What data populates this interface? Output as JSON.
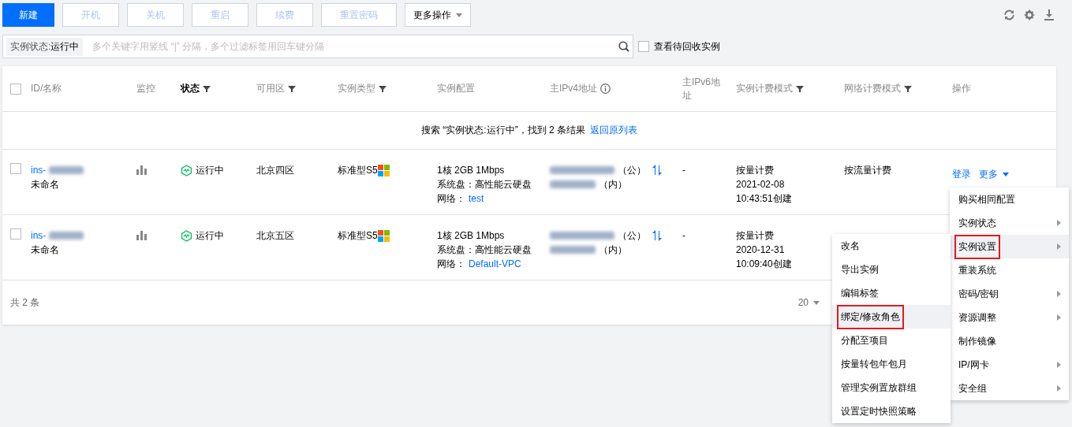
{
  "toolbar": {
    "buttons": [
      {
        "label": "新建",
        "kind": "primary",
        "disabled": false
      },
      {
        "label": "开机",
        "kind": "default",
        "disabled": true
      },
      {
        "label": "关机",
        "kind": "default",
        "disabled": true
      },
      {
        "label": "重启",
        "kind": "default",
        "disabled": true
      },
      {
        "label": "续费",
        "kind": "default",
        "disabled": true
      },
      {
        "label": "重置密码",
        "kind": "default",
        "disabled": true
      },
      {
        "label": "更多操作",
        "kind": "dropdown",
        "disabled": false
      }
    ]
  },
  "search": {
    "tag_key": "实例状态:",
    "tag_value": "运行中",
    "placeholder": "多个关键字用竖线 “|” 分隔，多个过滤标签用回车键分隔",
    "checkbox": {
      "label": "查看待回收实例",
      "checked": false
    }
  },
  "table": {
    "header_checked": false,
    "columns": [
      {
        "label": "ID/名称",
        "kind": "plain",
        "active": false
      },
      {
        "label": "监控",
        "kind": "plain",
        "active": false
      },
      {
        "label": "状态",
        "kind": "filter",
        "active": true
      },
      {
        "label": "可用区",
        "kind": "filter",
        "active": false
      },
      {
        "label": "实例类型",
        "kind": "filter",
        "active": false
      },
      {
        "label": "实例配置",
        "kind": "plain",
        "active": false
      },
      {
        "label": "主IPv4地址",
        "kind": "info",
        "active": false
      },
      {
        "label": "主IPv6地址",
        "kind": "plain",
        "active": false
      },
      {
        "label": "实例计费模式",
        "kind": "filter",
        "active": false
      },
      {
        "label": "网络计费模式",
        "kind": "filter",
        "active": false
      },
      {
        "label": "操作",
        "kind": "plain",
        "active": false
      }
    ],
    "search_result": {
      "text": "搜索 “实例状态:运行中”，找到 2 条结果",
      "link": "返回原列表"
    },
    "rows": [
      {
        "checked": false,
        "id_prefix": "ins-",
        "name": "未命名",
        "status": "运行中",
        "zone": "北京四区",
        "type": "标准型S5",
        "config": [
          "1核 2GB 1Mbps",
          "系统盘：高性能云硬盘"
        ],
        "network_label": "网络：",
        "network": "test",
        "public_suffix": "（公）",
        "private_suffix": "（内）",
        "ipv6": "-",
        "billing": [
          "按量计费",
          "2021-02-08",
          "10:43:51创建"
        ],
        "net_billing": "按流量计费",
        "actions": [
          "登录",
          "更多"
        ]
      },
      {
        "checked": false,
        "id_prefix": "ins-",
        "name": "未命名",
        "status": "运行中",
        "zone": "北京五区",
        "type": "标准型S5",
        "config": [
          "1核 2GB 1Mbps",
          "系统盘：高性能云硬盘"
        ],
        "network_label": "网络：",
        "network": "Default-VPC",
        "public_suffix": "（公）",
        "private_suffix": "（内）",
        "ipv6": "-",
        "billing": [
          "按量计费",
          "2020-12-31",
          "10:09:40创建"
        ]
      }
    ],
    "footer": {
      "total": "共 2 条",
      "page_size": "20"
    }
  },
  "menu": {
    "items": [
      {
        "label": "购买相同配置",
        "submenu": false,
        "selected": false
      },
      {
        "label": "实例状态",
        "submenu": true,
        "selected": false
      },
      {
        "label": "实例设置",
        "submenu": true,
        "selected": true
      },
      {
        "label": "重装系统",
        "submenu": false,
        "selected": false
      },
      {
        "label": "密码/密钥",
        "submenu": true,
        "selected": false
      },
      {
        "label": "资源调整",
        "submenu": true,
        "selected": false
      },
      {
        "label": "制作镜像",
        "submenu": false,
        "selected": false
      },
      {
        "label": "IP/网卡",
        "submenu": true,
        "selected": false
      },
      {
        "label": "安全组",
        "submenu": true,
        "selected": false
      }
    ]
  },
  "submenu": {
    "items": [
      {
        "label": "改名",
        "selected": false
      },
      {
        "label": "导出实例",
        "selected": false
      },
      {
        "label": "编辑标签",
        "selected": false
      },
      {
        "label": "绑定/修改角色",
        "selected": true
      },
      {
        "label": "分配至项目",
        "selected": false
      },
      {
        "label": "按量转包年包月",
        "selected": false
      },
      {
        "label": "管理实例置放群组",
        "selected": false
      },
      {
        "label": "设置定时快照策略",
        "selected": false
      }
    ]
  }
}
